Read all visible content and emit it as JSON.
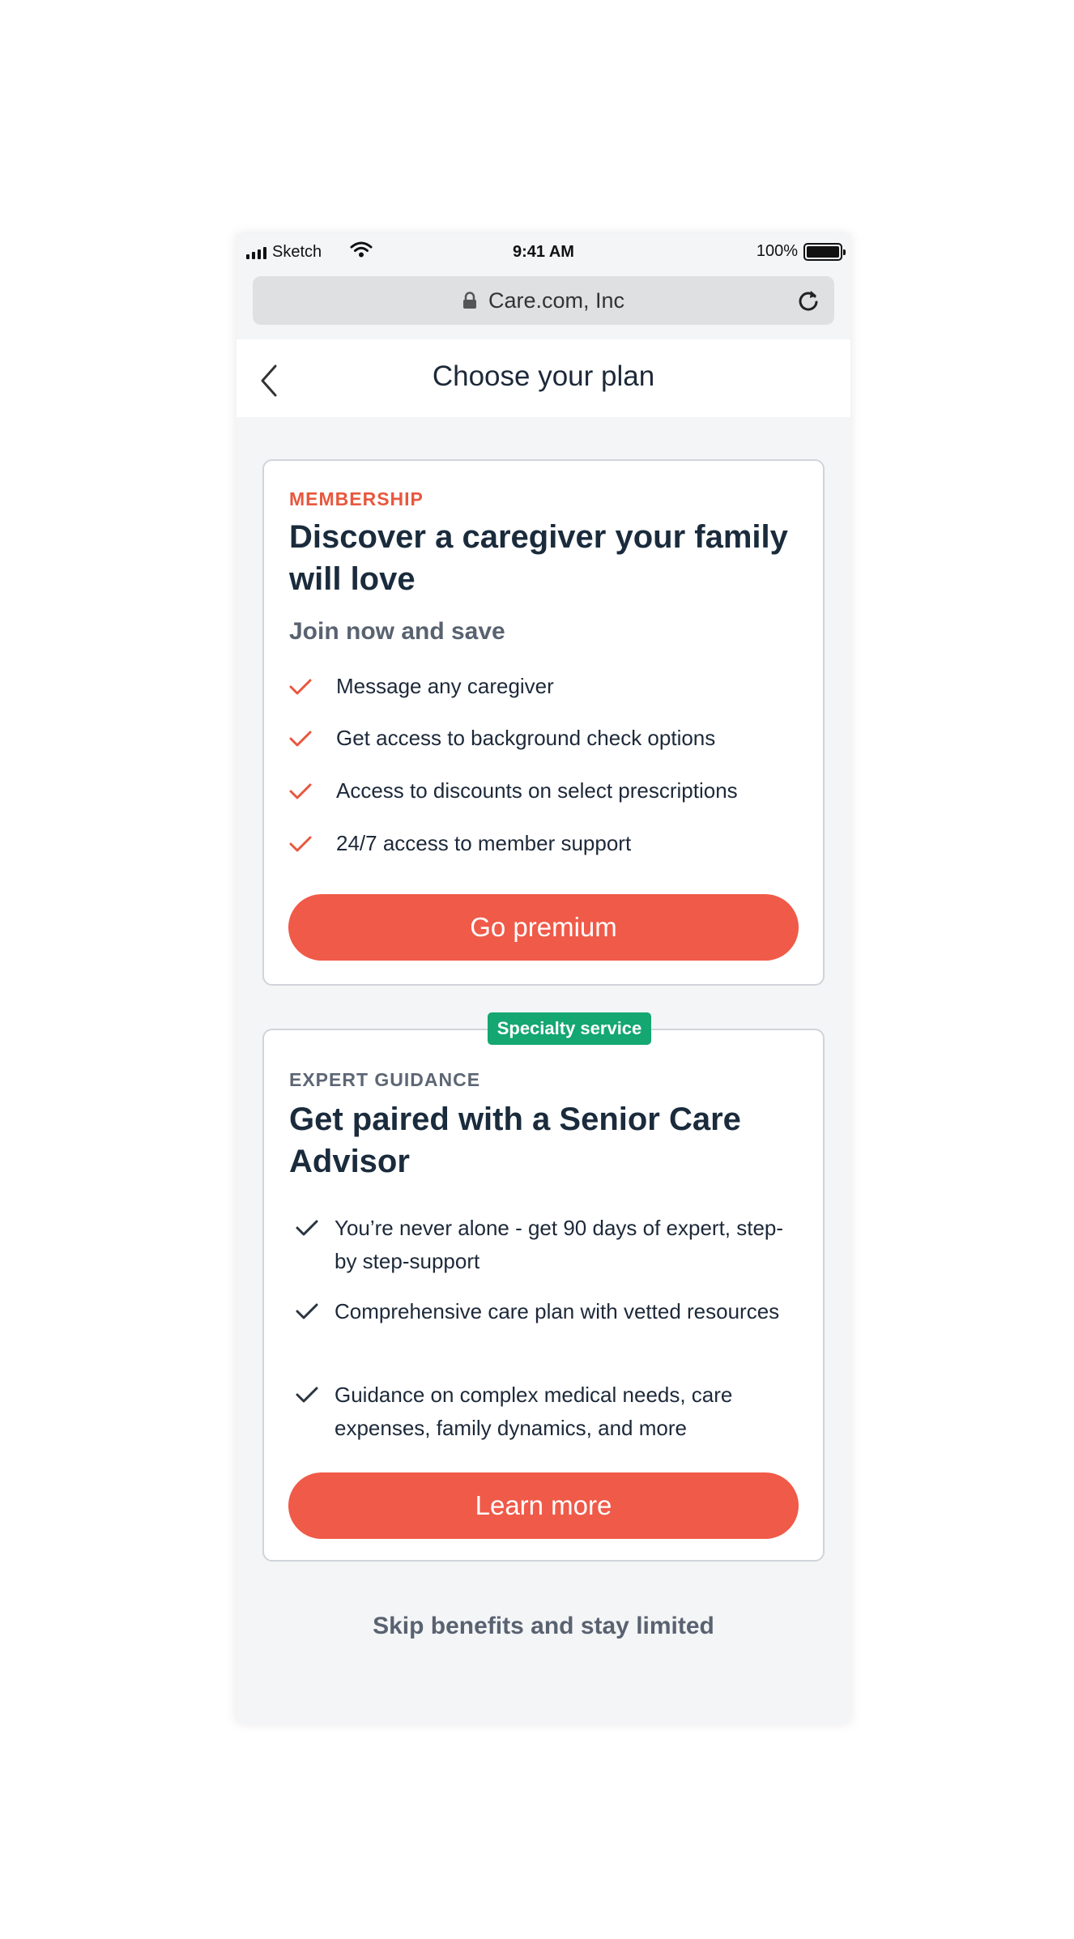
{
  "status_bar": {
    "carrier": "Sketch",
    "time": "9:41 AM",
    "battery": "100%"
  },
  "browser": {
    "url": "Care.com, Inc"
  },
  "header": {
    "title": "Choose your plan"
  },
  "membership_card": {
    "eyebrow": "MEMBERSHIP",
    "headline": "Discover a caregiver your family will love",
    "subhead": "Join now and save",
    "features": [
      "Message any caregiver",
      "Get access to background check options",
      "Access to discounts on select prescriptions",
      "24/7 access to member support"
    ],
    "button_label": "Go premium",
    "accent_color": "#e8573e"
  },
  "guidance_card": {
    "badge": "Specialty service",
    "eyebrow": "EXPERT GUIDANCE",
    "headline": "Get paired with a Senior Care Advisor",
    "features": [
      "You’re never alone - get 90 days of expert, step-by step-support",
      "Comprehensive care plan with vetted resources",
      "Guidance on complex medical needs, care expenses, family dynamics, and more"
    ],
    "button_label": "Learn more",
    "badge_color": "#14a772"
  },
  "skip_link": "Skip benefits and stay limited",
  "icons": {
    "signal": "signal-icon",
    "wifi": "wifi-icon",
    "battery": "battery-icon",
    "lock": "lock-icon",
    "reload": "reload-icon",
    "back": "back-icon",
    "check": "check-icon"
  }
}
